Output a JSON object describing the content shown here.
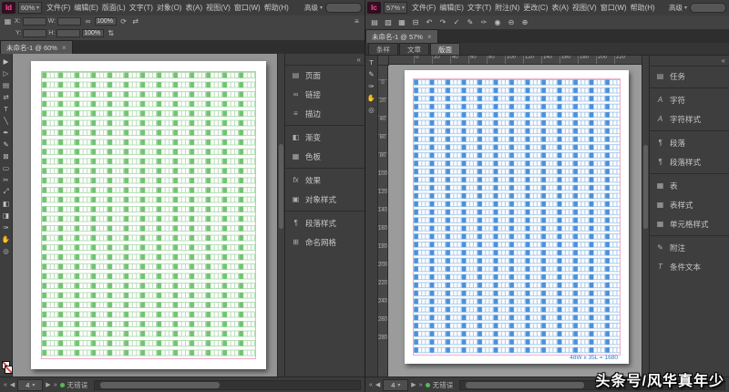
{
  "watermark": "头条号/风华真年少",
  "ui": {
    "collapse_glyph": "«",
    "caret": "▾",
    "link_glyph": "∞",
    "rotate_glyph": "⟳",
    "flip_h_glyph": "⇄",
    "flip_v_glyph": "⇅",
    "panel_menu_glyph": "≡",
    "proxy_glyph": "▦",
    "nav_first": "«",
    "nav_prev": "◀",
    "nav_next": "▶",
    "nav_last": "»"
  },
  "left": {
    "app_logo": "Id",
    "zoom": "60%",
    "menus": [
      "文件(F)",
      "编辑(E)",
      "版面(L)",
      "文字(T)",
      "对象(O)",
      "表(A)",
      "视图(V)",
      "窗口(W)",
      "帮助(H)"
    ],
    "workspace": "高级",
    "control": {
      "x_label": "X:",
      "y_label": "Y:",
      "w_label": "W:",
      "h_label": "H:",
      "x_value": "",
      "y_value": "",
      "w_value": "",
      "h_value": "",
      "scale_x": "100%",
      "scale_y": "100%"
    },
    "tab_title": "未命名-1 @ 60%",
    "tab_close": "×",
    "tools": [
      {
        "name": "selection-tool-icon",
        "glyph": "▶"
      },
      {
        "name": "direct-selection-tool-icon",
        "glyph": "▷"
      },
      {
        "name": "page-tool-icon",
        "glyph": "▤"
      },
      {
        "name": "gap-tool-icon",
        "glyph": "⇄"
      },
      {
        "name": "type-tool-icon",
        "glyph": "T"
      },
      {
        "name": "line-tool-icon",
        "glyph": "╲"
      },
      {
        "name": "pen-tool-icon",
        "glyph": "✒"
      },
      {
        "name": "pencil-tool-icon",
        "glyph": "✎"
      },
      {
        "name": "frame-tool-icon",
        "glyph": "⊠"
      },
      {
        "name": "rectangle-tool-icon",
        "glyph": "▭"
      },
      {
        "name": "scissors-tool-icon",
        "glyph": "✂"
      },
      {
        "name": "free-transform-tool-icon",
        "glyph": "⤢"
      },
      {
        "name": "gradient-tool-icon",
        "glyph": "◧"
      },
      {
        "name": "gradient-feather-tool-icon",
        "glyph": "◨"
      },
      {
        "name": "eyedropper-tool-icon",
        "glyph": "✑"
      },
      {
        "name": "hand-tool-icon",
        "glyph": "✋"
      },
      {
        "name": "zoom-tool-icon",
        "glyph": "◎"
      }
    ],
    "dock_groups": [
      [
        {
          "label": "页面",
          "glyph": "▤",
          "name": "pages-panel"
        },
        {
          "label": "链接",
          "glyph": "∞",
          "name": "links-panel"
        },
        {
          "label": "描边",
          "glyph": "≡",
          "name": "stroke-panel"
        }
      ],
      [
        {
          "label": "渐变",
          "glyph": "◧",
          "name": "gradient-panel"
        },
        {
          "label": "色板",
          "glyph": "▦",
          "name": "swatches-panel"
        }
      ],
      [
        {
          "label": "效果",
          "glyph": "fx",
          "name": "effects-panel"
        },
        {
          "label": "对象样式",
          "glyph": "▣",
          "name": "object-styles-panel"
        }
      ],
      [
        {
          "label": "段落样式",
          "glyph": "¶",
          "name": "paragraph-styles-panel"
        },
        {
          "label": "命名网格",
          "glyph": "⊞",
          "name": "named-grids-panel"
        }
      ]
    ],
    "status_page": "4",
    "status_preflight": "无错误"
  },
  "right": {
    "app_logo": "Ic",
    "zoom": "57%",
    "menus": [
      "文件(F)",
      "编辑(E)",
      "文字(T)",
      "附注(N)",
      "更改(C)",
      "表(A)",
      "视图(V)",
      "窗口(W)",
      "帮助(H)"
    ],
    "workspace": "高级",
    "toolbar": [
      {
        "name": "new-document-icon",
        "glyph": "▤"
      },
      {
        "name": "open-document-icon",
        "glyph": "▧"
      },
      {
        "name": "save-icon",
        "glyph": "▦"
      },
      {
        "name": "print-icon",
        "glyph": "⊟"
      },
      {
        "name": "undo-icon",
        "glyph": "↶"
      },
      {
        "name": "redo-icon",
        "glyph": "↷"
      },
      {
        "name": "spellcheck-icon",
        "glyph": "✓"
      },
      {
        "name": "note-icon",
        "glyph": "✎"
      },
      {
        "name": "track-changes-icon",
        "glyph": "✑"
      },
      {
        "name": "preview-icon",
        "glyph": "◉"
      },
      {
        "name": "zoom-out-icon",
        "glyph": "⊖"
      },
      {
        "name": "zoom-in-icon",
        "glyph": "⊕"
      }
    ],
    "tab_title": "未命名-1 @ 57%",
    "tab_close": "×",
    "view_tabs": [
      "条样",
      "文章",
      "版面"
    ],
    "h_ruler": [
      "0",
      "20",
      "40",
      "60",
      "80",
      "100",
      "120",
      "140",
      "160",
      "180",
      "200",
      "220"
    ],
    "v_ruler": [
      "0",
      "20",
      "40",
      "60",
      "80",
      "100",
      "120",
      "140",
      "160",
      "180",
      "200",
      "220",
      "240",
      "260",
      "280"
    ],
    "tools": [
      {
        "name": "type-tool-icon",
        "glyph": "T"
      },
      {
        "name": "note-tool-icon",
        "glyph": "✎"
      },
      {
        "name": "eyedropper-tool-icon",
        "glyph": "✑"
      },
      {
        "name": "hand-tool-icon",
        "glyph": "✋"
      },
      {
        "name": "zoom-tool-icon",
        "glyph": "◎"
      }
    ],
    "grid_note": "48W x 35L = 1680",
    "dock_groups": [
      [
        {
          "label": "任务",
          "glyph": "▤",
          "name": "assignments-panel"
        }
      ],
      [
        {
          "label": "字符",
          "glyph": "A",
          "name": "character-panel"
        },
        {
          "label": "字符样式",
          "glyph": "A",
          "name": "character-styles-panel"
        }
      ],
      [
        {
          "label": "段落",
          "glyph": "¶",
          "name": "paragraph-panel"
        },
        {
          "label": "段落样式",
          "glyph": "¶",
          "name": "paragraph-styles-panel"
        }
      ],
      [
        {
          "label": "表",
          "glyph": "▦",
          "name": "table-panel"
        },
        {
          "label": "表样式",
          "glyph": "▦",
          "name": "table-styles-panel"
        },
        {
          "label": "单元格样式",
          "glyph": "▦",
          "name": "cell-styles-panel"
        }
      ],
      [
        {
          "label": "附注",
          "glyph": "✎",
          "name": "notes-panel"
        },
        {
          "label": "条件文本",
          "glyph": "T",
          "name": "conditional-text-panel"
        }
      ]
    ],
    "status_page": "4",
    "status_preflight": "无错误"
  }
}
